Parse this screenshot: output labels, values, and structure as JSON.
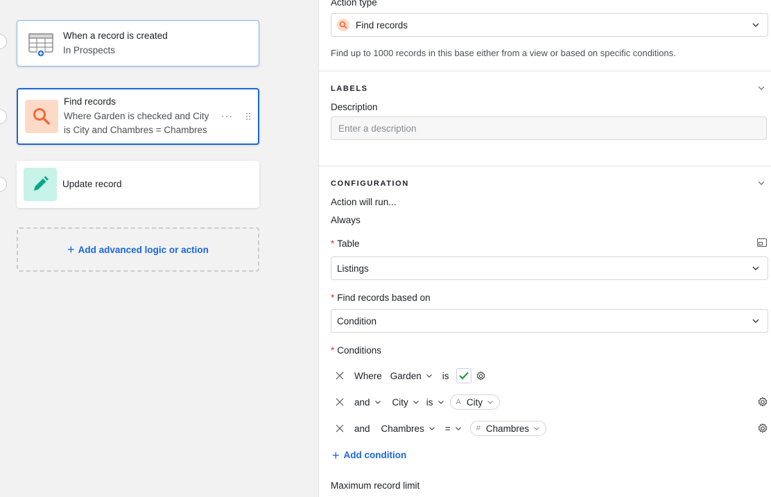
{
  "canvas": {
    "trigger": {
      "title": "When a record is created",
      "subtitle": "In Prospects",
      "icon": "table-icon"
    },
    "find": {
      "title": "Find records",
      "subtitle": "Where Garden is checked and City is City and Chambres = Chambres",
      "more": "···",
      "icon": "search-icon"
    },
    "update": {
      "title": "Update record",
      "icon": "pencil-icon"
    },
    "add_action": "Add advanced logic or action"
  },
  "panel": {
    "action_type_label": "Action type",
    "action_type_value": "Find records",
    "action_type_help": "Find up to 1000 records in this base either from a view or based on specific conditions.",
    "labels_section": "LABELS",
    "description_label": "Description",
    "description_placeholder": "Enter a description",
    "config_section": "CONFIGURATION",
    "action_will_run_label": "Action will run...",
    "action_will_run_value": "Always",
    "table_label": "Table",
    "table_value": "Listings",
    "find_based_on_label": "Find records based on",
    "find_based_on_value": "Condition",
    "conditions_label": "Conditions",
    "conditions": [
      {
        "connector": "Where",
        "field": "Garden",
        "operator": "is",
        "value_type": "checkbox",
        "value": ""
      },
      {
        "connector": "and",
        "field": "City",
        "operator": "is",
        "value_type": "text",
        "value": "City",
        "value_icon": "A"
      },
      {
        "connector": "and",
        "field": "Chambres",
        "operator": "=",
        "value_type": "number",
        "value": "Chambres",
        "value_icon": "#"
      }
    ],
    "add_condition": "Add condition",
    "max_limit_label": "Maximum record limit"
  },
  "colors": {
    "accent": "#1a66db",
    "search_tile": "#fdd9c8",
    "edit_tile": "#c7f3e8",
    "check": "#1f9e3a"
  }
}
